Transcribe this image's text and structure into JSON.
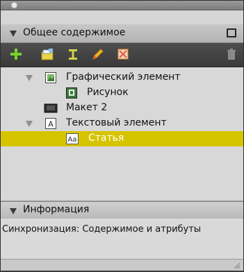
{
  "panel": {
    "header": {
      "title": "Общее содержимое"
    },
    "toolbar": {
      "buttons": [
        {
          "name": "add-icon"
        },
        {
          "name": "new-folder-icon"
        },
        {
          "name": "text-cursor-icon"
        },
        {
          "name": "pencil-icon"
        },
        {
          "name": "unlink-icon"
        },
        {
          "name": "trash-icon"
        }
      ]
    },
    "tree": {
      "items": [
        {
          "label": "Графический элемент",
          "icon": "image-icon"
        },
        {
          "label": "Рисунок",
          "icon": "picture-icon"
        },
        {
          "label": "Макет 2",
          "icon": "layout-icon"
        },
        {
          "label": "Текстовый элемент",
          "icon": "text-element-icon"
        },
        {
          "label": "Статья",
          "icon": "story-icon"
        }
      ]
    },
    "info": {
      "title": "Информация",
      "text": "Синхронизация: Содержимое и атрибуты"
    }
  }
}
